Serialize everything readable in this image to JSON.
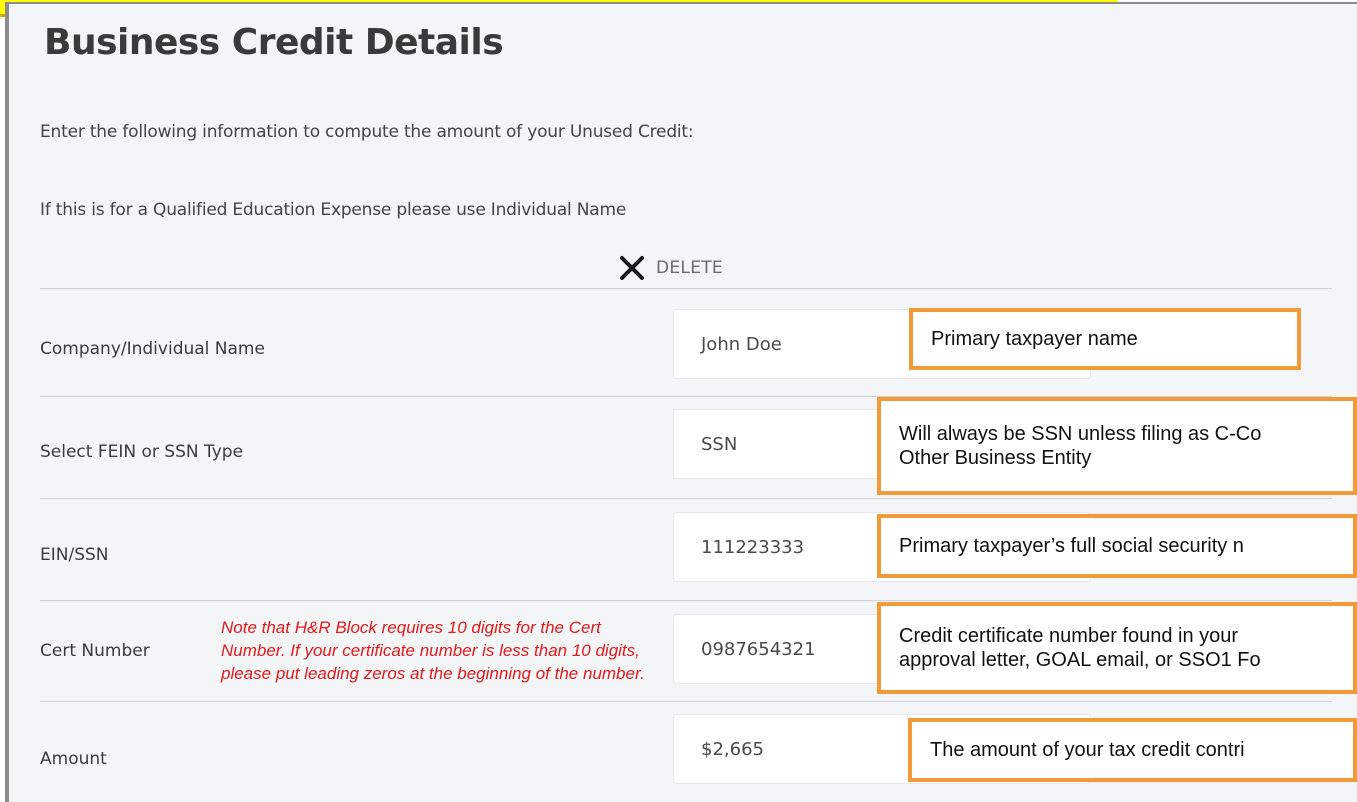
{
  "page": {
    "title": "Business Credit Details",
    "intro": "Enter the following information to compute the amount of your Unused Credit:",
    "qualified_note": "If this is for a Qualified Education Expense please use Individual Name",
    "delete_label": "DELETE",
    "delete_icon": "close-x-icon"
  },
  "fields": [
    {
      "label": "Company/Individual Name",
      "value": "John Doe",
      "callout": "Primary taxpayer name"
    },
    {
      "label": "Select FEIN or SSN Type",
      "value": "SSN",
      "callout_line1": "Will always be SSN unless filing as C-Co",
      "callout_line2": "Other Business Entity"
    },
    {
      "label": "EIN/SSN",
      "value": "111223333",
      "callout": "Primary taxpayer’s full social security n"
    },
    {
      "label": "Cert Number",
      "value": "0987654321",
      "callout_line1": "Credit certificate number found in your",
      "callout_line2": "approval letter, GOAL email, or SSO1 Fo"
    },
    {
      "label": "Amount",
      "value": "$2,665",
      "callout": "The amount of your tax credit contri"
    }
  ],
  "cert_note": "Note that H&R Block requires 10 digits for the Cert Number. If your certificate number is less than 10 digits, please put leading zeros at the beginning of the number.",
  "colors": {
    "highlight": "#ffff00",
    "callout_border": "#f29a3a",
    "note_text": "#e3191c",
    "panel_bg": "#f3f5f7"
  }
}
